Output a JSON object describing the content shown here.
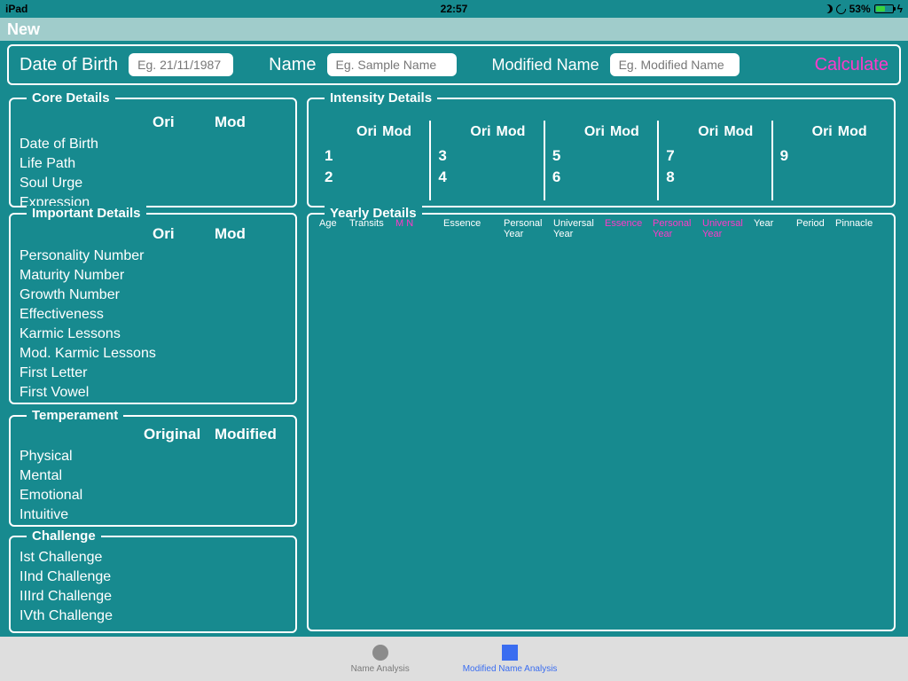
{
  "status": {
    "device": "iPad",
    "time": "22:57",
    "battery_pct": "53%"
  },
  "title": "New",
  "inputs": {
    "dob_label": "Date of Birth",
    "dob_placeholder": "Eg. 21/11/1987",
    "name_label": "Name",
    "name_placeholder": "Eg. Sample Name",
    "modname_label": "Modified Name",
    "modname_placeholder": "Eg. Modified Name",
    "calc": "Calculate"
  },
  "core": {
    "legend": "Core Details",
    "h_ori": "Ori",
    "h_mod": "Mod",
    "rows": [
      "Date of Birth",
      "Life Path",
      "Soul Urge",
      "Expression"
    ]
  },
  "important": {
    "legend": "Important Details",
    "h_ori": "Ori",
    "h_mod": "Mod",
    "rows": [
      "Personality Number",
      "Maturity Number",
      "Growth Number",
      "Effectiveness",
      "Karmic Lessons",
      "Mod. Karmic Lessons",
      "First Letter",
      "First Vowel"
    ]
  },
  "temperament": {
    "legend": "Temperament",
    "h_ori": "Original",
    "h_mod": "Modified",
    "rows": [
      "Physical",
      "Mental",
      "Emotional",
      "Intuitive"
    ]
  },
  "challenge": {
    "legend": "Challenge",
    "rows": [
      "Ist Challenge",
      "IInd Challenge",
      "IIIrd Challenge",
      "IVth Challenge"
    ]
  },
  "intensity": {
    "legend": "Intensity Details",
    "h_ori": "Ori",
    "h_mod": "Mod",
    "cols": [
      {
        "nums": [
          "1",
          "2"
        ]
      },
      {
        "nums": [
          "3",
          "4"
        ]
      },
      {
        "nums": [
          "5",
          "6"
        ]
      },
      {
        "nums": [
          "7",
          "8"
        ]
      },
      {
        "nums": [
          "9"
        ]
      }
    ]
  },
  "yearly": {
    "legend": "Yearly Details",
    "heads": {
      "age": "Age",
      "transits": "Transits",
      "mn": "M N",
      "essence": "Essence",
      "py": "Personal Year",
      "uy": "Universal Year",
      "essence2": "Essence",
      "py2": "Personal Year",
      "uy2": "Universal Year",
      "year": "Year",
      "period": "Period",
      "pinnacle": "Pinnacle"
    }
  },
  "tabs": {
    "t1": "Name Analysis",
    "t2": "Modified Name Analysis"
  }
}
